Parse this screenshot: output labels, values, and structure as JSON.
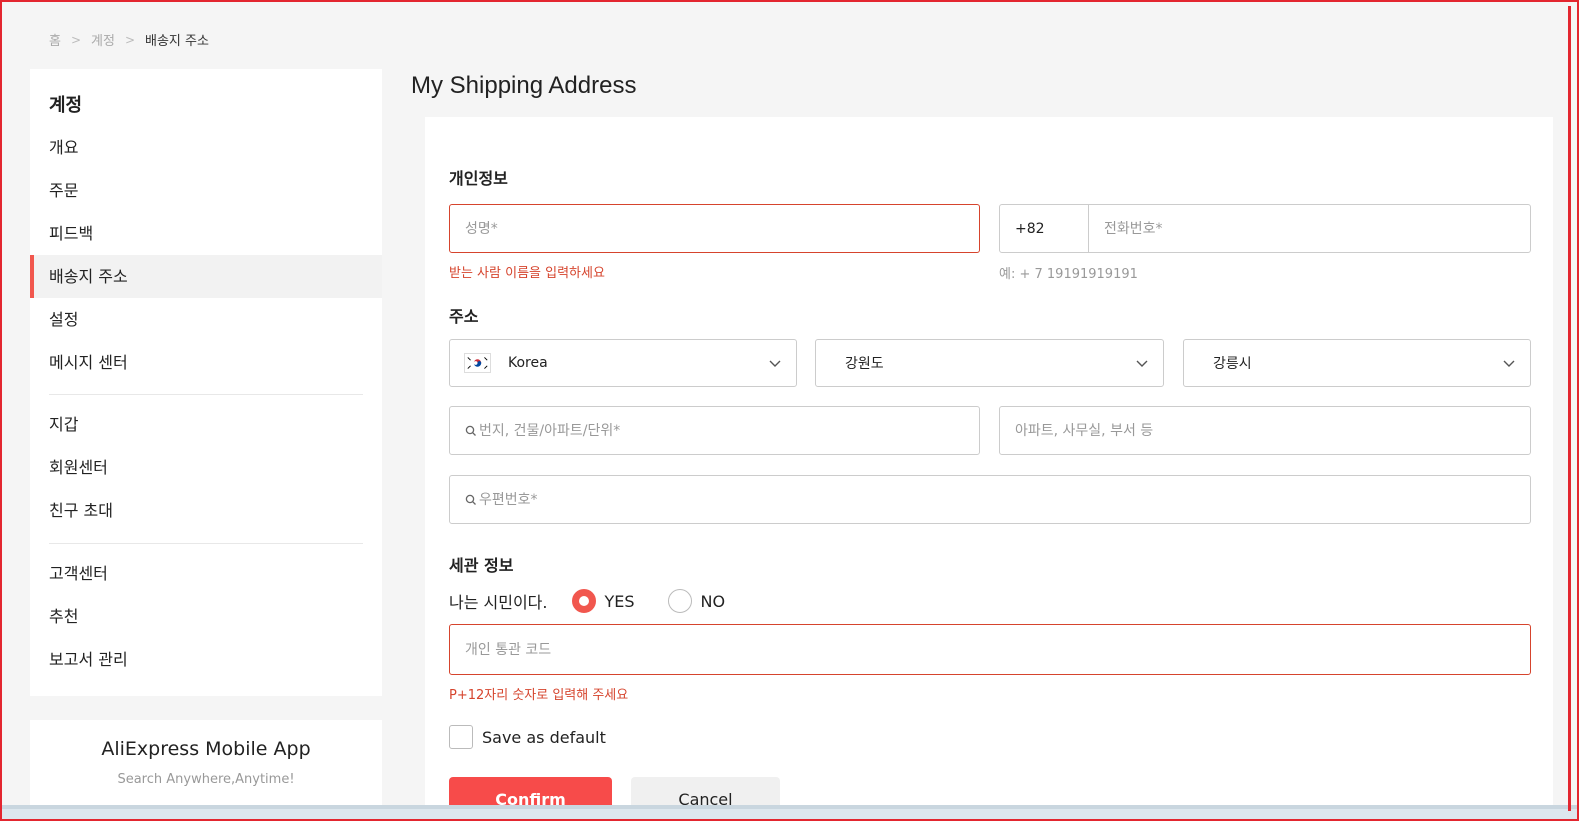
{
  "breadcrumb": {
    "home": "홈",
    "account": "계정",
    "current": "배송지 주소",
    "separator": ">"
  },
  "sidebar": {
    "title": "계정",
    "items": [
      {
        "label": "개요"
      },
      {
        "label": "주문"
      },
      {
        "label": "피드백"
      },
      {
        "label": "배송지 주소"
      },
      {
        "label": "설정"
      },
      {
        "label": "메시지 센터"
      },
      {
        "label": "지갑"
      },
      {
        "label": "회원센터"
      },
      {
        "label": "친구 초대"
      },
      {
        "label": "고객센터"
      },
      {
        "label": "추천"
      },
      {
        "label": "보고서 관리"
      }
    ],
    "active_item": "배송지 주소"
  },
  "app_card": {
    "title": "AliExpress Mobile App",
    "subtitle": "Search Anywhere,Anytime!"
  },
  "main": {
    "title": "My Shipping Address",
    "personal": {
      "section_title": "개인정보",
      "name_placeholder": "성명*",
      "name_error": "받는 사람 이름을 입력하세요",
      "phone_code": "+82",
      "phone_placeholder": "전화번호*",
      "phone_hint": "예: + 7 19191919191"
    },
    "address": {
      "section_title": "주소",
      "country": "Korea",
      "province": "강원도",
      "city": "강릉시",
      "street_placeholder": "번지, 건물/아파트/단위*",
      "detail_placeholder": "아파트, 사무실, 부서 등",
      "zip_placeholder": "우편번호*"
    },
    "customs": {
      "section_title": "세관 정보",
      "citizen_question": "나는 시민이다.",
      "yes_label": "YES",
      "no_label": "NO",
      "selected": "YES",
      "code_placeholder": "개인 통관 코드",
      "code_error": "P+12자리 숫자로 입력해 주세요"
    },
    "default_label": "Save as default",
    "default_checked": false,
    "confirm_label": "Confirm",
    "cancel_label": "Cancel"
  },
  "colors": {
    "accent": "#f74b4a",
    "error": "#d6442d",
    "active_bar": "#f1574e"
  }
}
